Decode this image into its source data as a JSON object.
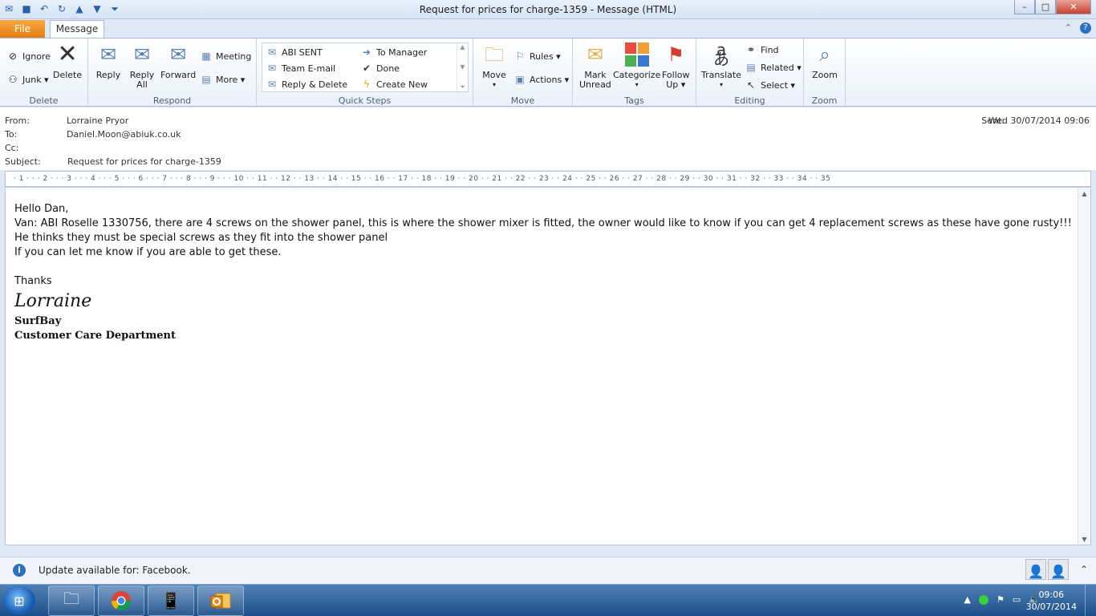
{
  "window": {
    "title": "Request for prices for charge-1359  -  Message (HTML)",
    "minimize": "–",
    "maximize": "□",
    "close": "✕"
  },
  "tabs": {
    "file": "File",
    "message": "Message"
  },
  "ribbon": {
    "delete_group": {
      "label": "Delete",
      "ignore": "Ignore",
      "junk": "Junk ▾",
      "delete": "Delete"
    },
    "respond_group": {
      "label": "Respond",
      "reply": "Reply",
      "reply_all_1": "Reply",
      "reply_all_2": "All",
      "forward": "Forward",
      "meeting": "Meeting",
      "more": "More ▾"
    },
    "quicksteps_group": {
      "label": "Quick Steps",
      "items": [
        "ABI SENT",
        "To Manager",
        "Team E-mail",
        "Done",
        "Reply & Delete",
        "Create New"
      ]
    },
    "move_group": {
      "label": "Move",
      "move": "Move",
      "rules": "Rules ▾",
      "actions": "Actions ▾"
    },
    "tags_group": {
      "label": "Tags",
      "mark_unread_1": "Mark",
      "mark_unread_2": "Unread",
      "categorize": "Categorize",
      "follow_up_1": "Follow",
      "follow_up_2": "Up ▾"
    },
    "editing_group": {
      "label": "Editing",
      "translate": "Translate",
      "find": "Find",
      "related": "Related ▾",
      "select": "Select ▾"
    },
    "zoom_group": {
      "label": "Zoom",
      "zoom": "Zoom"
    }
  },
  "header": {
    "from_label": "From:",
    "from_value": "Lorraine Pryor",
    "to_label": "To:",
    "to_value": "Daniel.Moon@abiuk.co.uk",
    "cc_label": "Cc:",
    "subject_label": "Subject:",
    "subject_value": "Request for prices for charge-1359",
    "sent_label": "Sent:",
    "sent_value": "Wed 30/07/2014 09:06"
  },
  "ruler_text": "· 1 · · · 2 · · · 3 · · · 4 · · · 5 · · · 6 · · · 7 · · · 8 · · · 9 · · · 10 · · 11 · · 12 · · 13 · · 14 · · 15 · · 16 · · 17 · · 18 · · 19 · · 20 · · 21 · · 22 · · 23 · · 24 · · 25 · · 26 · · 27 · · 28 · · 29 · · 30 · · 31 · · 32 · · 33 · · 34 · · 35",
  "message": {
    "greeting": "Hello Dan,",
    "line1": "Van: ABI Roselle 1330756, there are 4 screws on the shower panel, this is where the shower mixer is fitted, the owner would like to know if you can get 4 replacement screws as these have gone rusty!!! He thinks they must be special screws as they fit into the shower panel",
    "line2": "If you can let me know if you are able to get these.",
    "thanks": "Thanks",
    "signature_name": "Lorraine",
    "signature_company": "SurfBay",
    "signature_department": "Customer Care Department"
  },
  "infobar": {
    "text": "Update available for: Facebook."
  },
  "taskbar": {
    "time": "09:06",
    "date": "30/07/2014"
  }
}
